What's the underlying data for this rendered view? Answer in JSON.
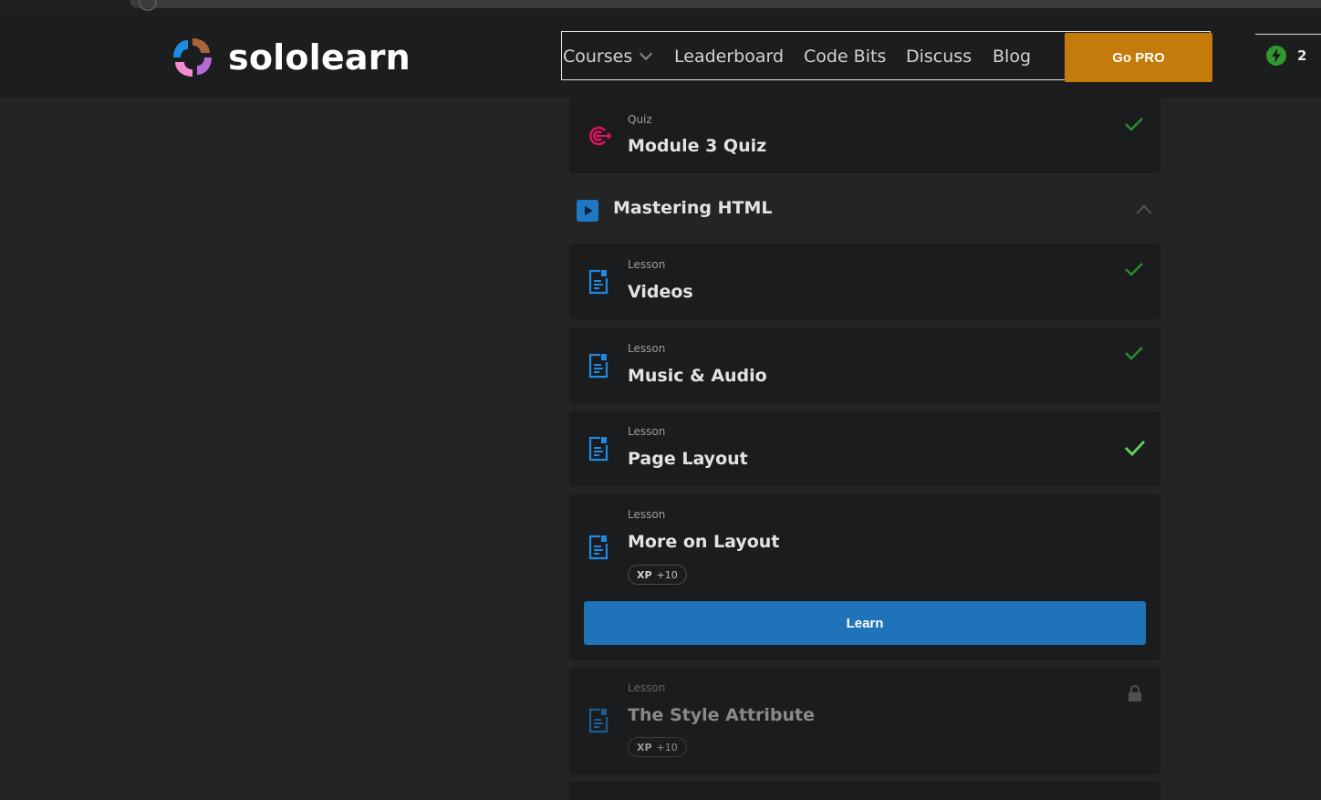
{
  "header": {
    "logo_text": "sololearn",
    "nav": {
      "courses": "Courses",
      "leaderboard": "Leaderboard",
      "code_bits": "Code Bits",
      "discuss": "Discuss",
      "blog": "Blog"
    },
    "go_pro": "Go PRO",
    "streak_count": "2"
  },
  "quiz_card": {
    "kind": "Quiz",
    "title": "Module 3 Quiz",
    "completed": true
  },
  "section": {
    "title": "Mastering HTML",
    "expanded": true
  },
  "lessons": [
    {
      "kind": "Lesson",
      "title": "Videos",
      "completed": true
    },
    {
      "kind": "Lesson",
      "title": "Music & Audio",
      "completed": true
    },
    {
      "kind": "Lesson",
      "title": "Page Layout",
      "completed": true
    },
    {
      "kind": "Lesson",
      "title": "More on Layout",
      "xp_label": "XP",
      "xp_value": "+10",
      "button": "Learn"
    },
    {
      "kind": "Lesson",
      "title": "The Style Attribute",
      "xp_label": "XP",
      "xp_value": "+10",
      "locked": true
    }
  ],
  "colors": {
    "accent_blue": "#1e73b9",
    "pro_orange": "#c57b0c",
    "check_green": "#2e8b2e",
    "check_green_active": "#5fd35f",
    "quiz_pink": "#e3125f"
  }
}
